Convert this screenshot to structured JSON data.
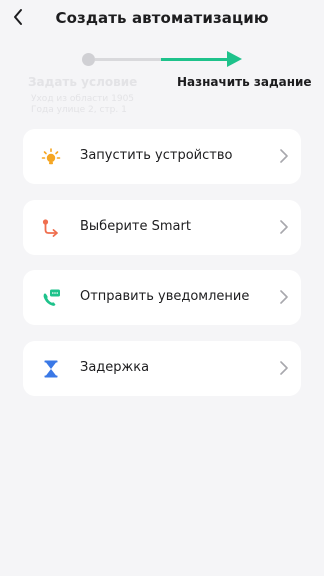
{
  "header": {
    "title": "Создать автоматизацию",
    "back_icon": "back-arrow-icon"
  },
  "steps": {
    "step1": {
      "label": "Задать условие",
      "line1": "Уход из области 1905",
      "line2": "Года улице 2, стр. 1"
    },
    "step2": {
      "label": "Назначить задание"
    },
    "active_color": "#1ec28b"
  },
  "actions": [
    {
      "label": "Запустить устройство",
      "icon": "lightbulb-icon",
      "color": "#f5a623"
    },
    {
      "label": "Выберите Smart",
      "icon": "route-icon",
      "color": "#ef6e4e"
    },
    {
      "label": "Отправить уведомление",
      "icon": "phone-message-icon",
      "color": "#1ec28b"
    },
    {
      "label": "Задержка",
      "icon": "hourglass-icon",
      "color": "#3a78e6"
    }
  ]
}
